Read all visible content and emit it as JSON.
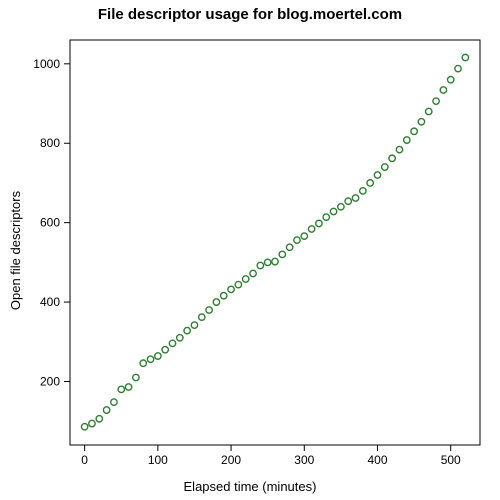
{
  "chart_data": {
    "type": "scatter",
    "title": "File descriptor usage for blog.moertel.com",
    "xlabel": "Elapsed time (minutes)",
    "ylabel": "Open file descriptors",
    "xlim": [
      -20,
      540
    ],
    "ylim": [
      40,
      1060
    ],
    "xticks": [
      0,
      100,
      200,
      300,
      400,
      500
    ],
    "yticks": [
      200,
      400,
      600,
      800,
      1000
    ],
    "marker_color": "#2f7d32",
    "x": [
      0,
      10,
      20,
      30,
      40,
      50,
      60,
      70,
      80,
      90,
      100,
      110,
      120,
      130,
      140,
      150,
      160,
      170,
      180,
      190,
      200,
      210,
      220,
      230,
      240,
      250,
      260,
      270,
      280,
      290,
      300,
      310,
      320,
      330,
      340,
      350,
      360,
      370,
      380,
      390,
      400,
      410,
      420,
      430,
      440,
      450,
      460,
      470,
      480,
      490,
      500,
      510,
      520
    ],
    "y": [
      86,
      94,
      106,
      128,
      148,
      180,
      186,
      210,
      246,
      256,
      264,
      280,
      296,
      310,
      328,
      342,
      362,
      380,
      400,
      416,
      432,
      444,
      458,
      472,
      492,
      500,
      502,
      520,
      538,
      556,
      566,
      584,
      598,
      614,
      628,
      640,
      654,
      662,
      680,
      700,
      720,
      740,
      762,
      784,
      808,
      830,
      854,
      880,
      906,
      934,
      960,
      988,
      1016
    ]
  }
}
